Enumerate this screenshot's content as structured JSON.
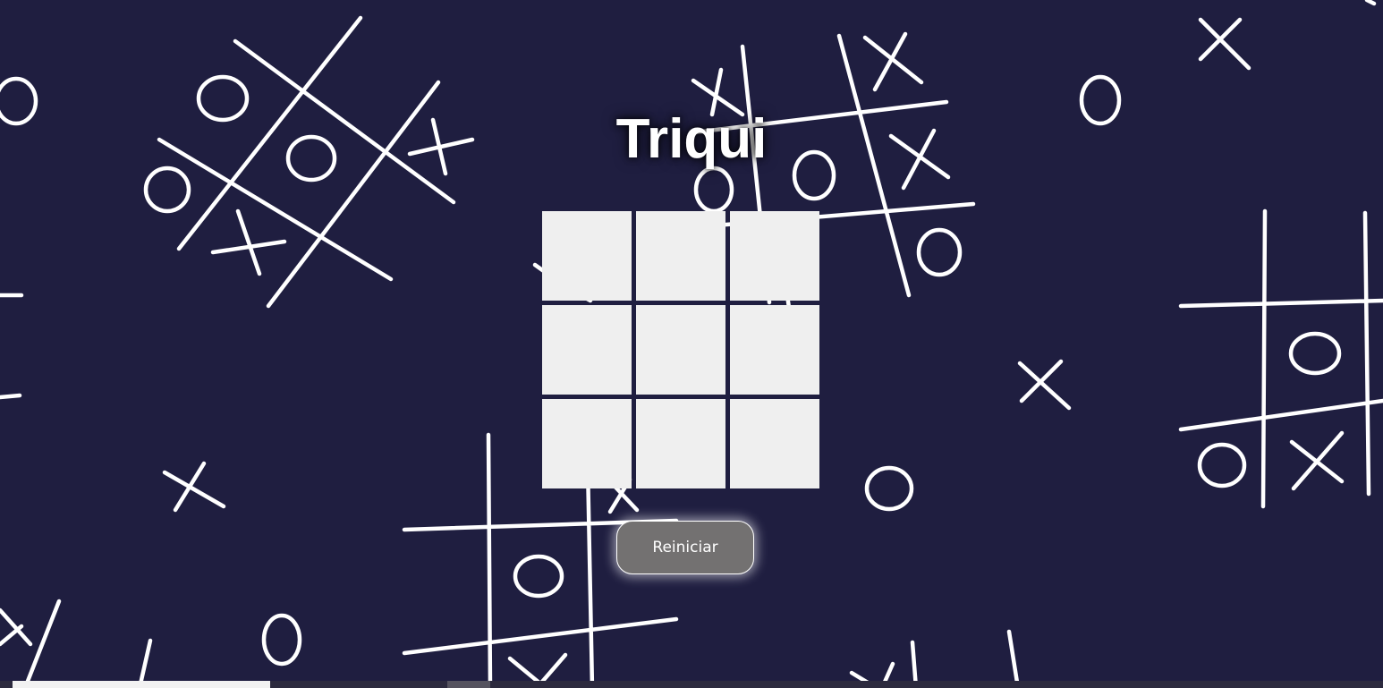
{
  "game": {
    "title": "Triqui",
    "board": [
      "",
      "",
      "",
      "",
      "",
      "",
      "",
      "",
      ""
    ],
    "reset_label": "Reiniciar"
  },
  "colors": {
    "background": "#1f1e40",
    "cell": "#efefef",
    "button": "#737171",
    "doodle": "#ffffff"
  }
}
